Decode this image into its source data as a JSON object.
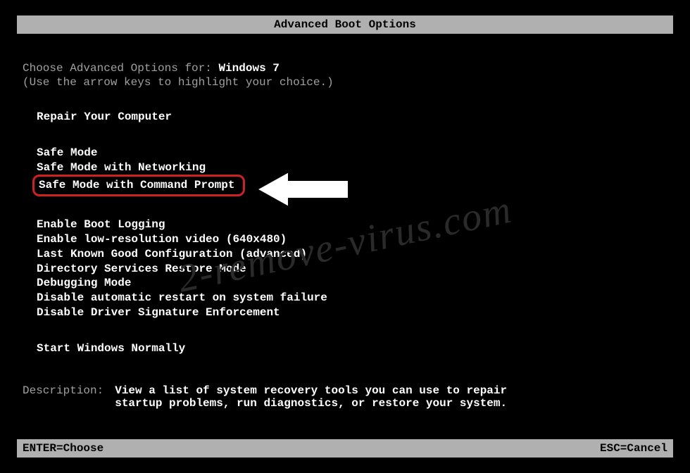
{
  "title": "Advanced Boot Options",
  "choose_prefix": "Choose Advanced Options for: ",
  "os_name": "Windows 7",
  "instruction": "(Use the arrow keys to highlight your choice.)",
  "group1": {
    "item0": "Repair Your Computer"
  },
  "group2": {
    "item0": "Safe Mode",
    "item1": "Safe Mode with Networking",
    "item2": "Safe Mode with Command Prompt"
  },
  "group3": {
    "item0": "Enable Boot Logging",
    "item1": "Enable low-resolution video (640x480)",
    "item2": "Last Known Good Configuration (advanced)",
    "item3": "Directory Services Restore Mode",
    "item4": "Debugging Mode",
    "item5": "Disable automatic restart on system failure",
    "item6": "Disable Driver Signature Enforcement"
  },
  "group4": {
    "item0": "Start Windows Normally"
  },
  "description": {
    "label": "Description:",
    "text": "View a list of system recovery tools you can use to repair startup problems, run diagnostics, or restore your system."
  },
  "footer": {
    "enter": "ENTER=Choose",
    "esc": "ESC=Cancel"
  },
  "watermark": "2-remove-virus.com"
}
